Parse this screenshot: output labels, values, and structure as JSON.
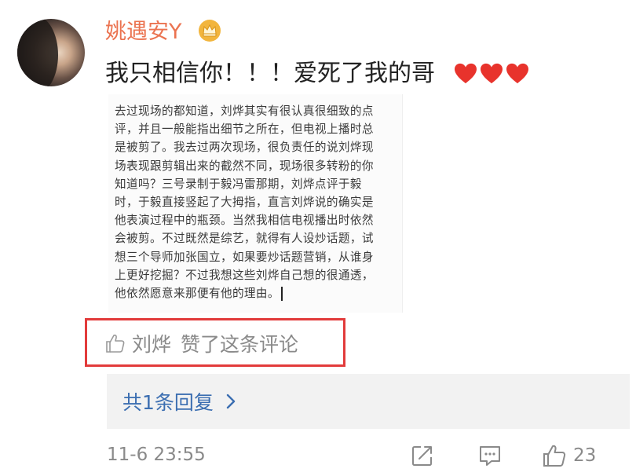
{
  "comment": {
    "user_name": "姚遇安Y",
    "text": "我只相信你！！！爱死了我的哥",
    "image_lines": [
      "去过现场的都知道，刘烨其实有很认真很细致的点",
      "评，并且一般能指出细节之所在，但电视上播时总",
      "是被剪了。我去过两次现场，很负责任的说刘烨现",
      "场表现跟剪辑出来的截然不同，现场很多转粉的你",
      "知道吗？三号录制于毅冯雷那期，刘烨点评于毅",
      "时，于毅直接竖起了大拇指，直言刘烨说的确实是",
      "他表演过程中的瓶颈。当然我相信电视播出时依然",
      "会被剪。不过既然是综艺，就得有人设炒话题，试",
      "想三个导师加张国立，如果要炒话题营销，从谁身",
      "上更好挖掘？不过我想这些刘烨自己想的很通透，",
      "他依然愿意来那便有他的理由。"
    ],
    "liked_by": "刘烨",
    "liked_text": "赞了这条评论",
    "replies_label": "共1条回复",
    "timestamp": "11-6 23:55",
    "like_count": "23"
  },
  "icons": {
    "badge": "crown-badge-icon",
    "hearts": [
      "heart-icon",
      "heart-icon",
      "heart-icon"
    ],
    "thumb": "thumbs-up-icon",
    "chevron": "chevron-right-icon",
    "share": "share-icon",
    "reply": "comment-icon",
    "like": "like-icon"
  },
  "colors": {
    "username": "#eb7350",
    "link": "#3b6eb1",
    "heart": "#e8332c",
    "highlight_box": "#e23b3b",
    "muted": "#8a8a8a"
  }
}
